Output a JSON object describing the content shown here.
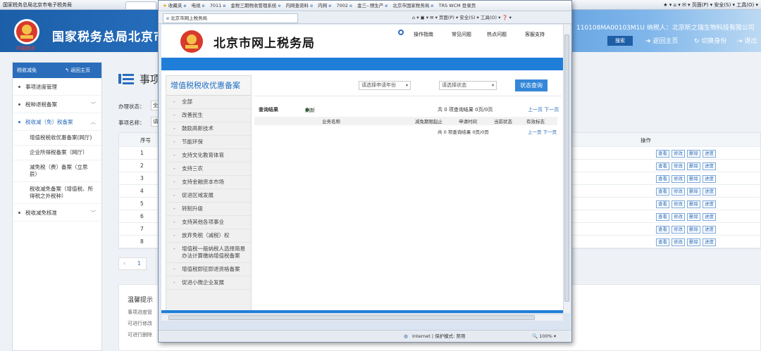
{
  "back_browser": {
    "window_title": "国家税务总局北京市电子税务局",
    "tools": "★ ▾ ⌂ ▾ ✉ ▾ 页面(P) ▾ 安全(S) ▾ 工具(O) ▾",
    "banner_title": "国家税务总局北京市",
    "tax_line": "110108MA00103M1U  纳税人：北京昕之瑞生物科技有限公司",
    "search_label": "搜索",
    "back_home": "返回主页",
    "switch_identity": "切换身份",
    "logout": "退出",
    "seal_text": "中国税务"
  },
  "back_sidebar": {
    "header": "税收减免",
    "back": "返回主页",
    "items": [
      {
        "label": "事项进度管理"
      },
      {
        "label": "税种退税备案"
      },
      {
        "label": "税收减（免）税备案"
      },
      {
        "label": "税收减免核准"
      }
    ],
    "subitems": [
      {
        "label": "增值税税收优惠备案(网厅)"
      },
      {
        "label": "企业所得税备案（网厅）"
      },
      {
        "label": "减免税（费）备案（立思辰）"
      },
      {
        "label": "税收减免备案（增值税、所得税之外税种）"
      }
    ]
  },
  "back_main": {
    "title": "事项",
    "status_label": "办理状态：",
    "status_value": "全",
    "name_label": "事项名称：",
    "name_placeholder": "请",
    "col_no": "序号",
    "col_op": "操作",
    "rows": [
      "1",
      "2",
      "3",
      "4",
      "5",
      "6",
      "7",
      "8"
    ],
    "ops": [
      "查看",
      "修改",
      "删除",
      "进度"
    ],
    "pager_prev": "‹",
    "pager_page": "1",
    "tips_title": "温馨提示",
    "tips": [
      "事项进度管",
      "可进行修改",
      "可进行删除"
    ]
  },
  "front": {
    "fav_label": "收藏夹",
    "fav_items": [
      "电视",
      "7011",
      "金税三期税收管理系统",
      "内网查资料",
      "内网",
      "7002",
      "金三--预生产",
      "北京市国家税务局",
      "TRS WCM 登录页"
    ],
    "tab_title": "北京市网上税务局",
    "tab_tools": "⌂ ▾ ▣ ▾ ✉ ▾ 页面(P) ▾ 安全(S) ▾ 工具(O) ▾ ❓ ▾",
    "status_text": "Internet | 保护模式: 禁用",
    "zoom": "100%"
  },
  "page": {
    "title": "北京市网上税务局",
    "nav": [
      "操作指南",
      "常见问题",
      "热点问题",
      "客服支持"
    ],
    "left_title": "增值税税收优惠备案",
    "left_items": [
      "全部",
      "改善民生",
      "鼓励高新技术",
      "节能环保",
      "支持文化教育体育",
      "支持三农",
      "支持金融资本市场",
      "促进区域发展",
      "转制升级",
      "支持其他各项事业",
      "放弃免税（减税）权",
      "增值税一般纳税人选择简易办法计算缴纳增值税备案",
      "增值税即征即退资格备案",
      "促进小微企业发展"
    ],
    "year_select": "请选择申请年份",
    "status_select": "请选择状态",
    "query_btn": "状态查询",
    "result_label": "查询结果",
    "refresh": "刷新",
    "count_text": "共 0 项查询结果 0页/0页",
    "prev_next": "上一页 下一页",
    "cols": [
      "业务名称",
      "减免期限起止",
      "申请时间",
      "当前状态",
      "有效标志"
    ]
  }
}
